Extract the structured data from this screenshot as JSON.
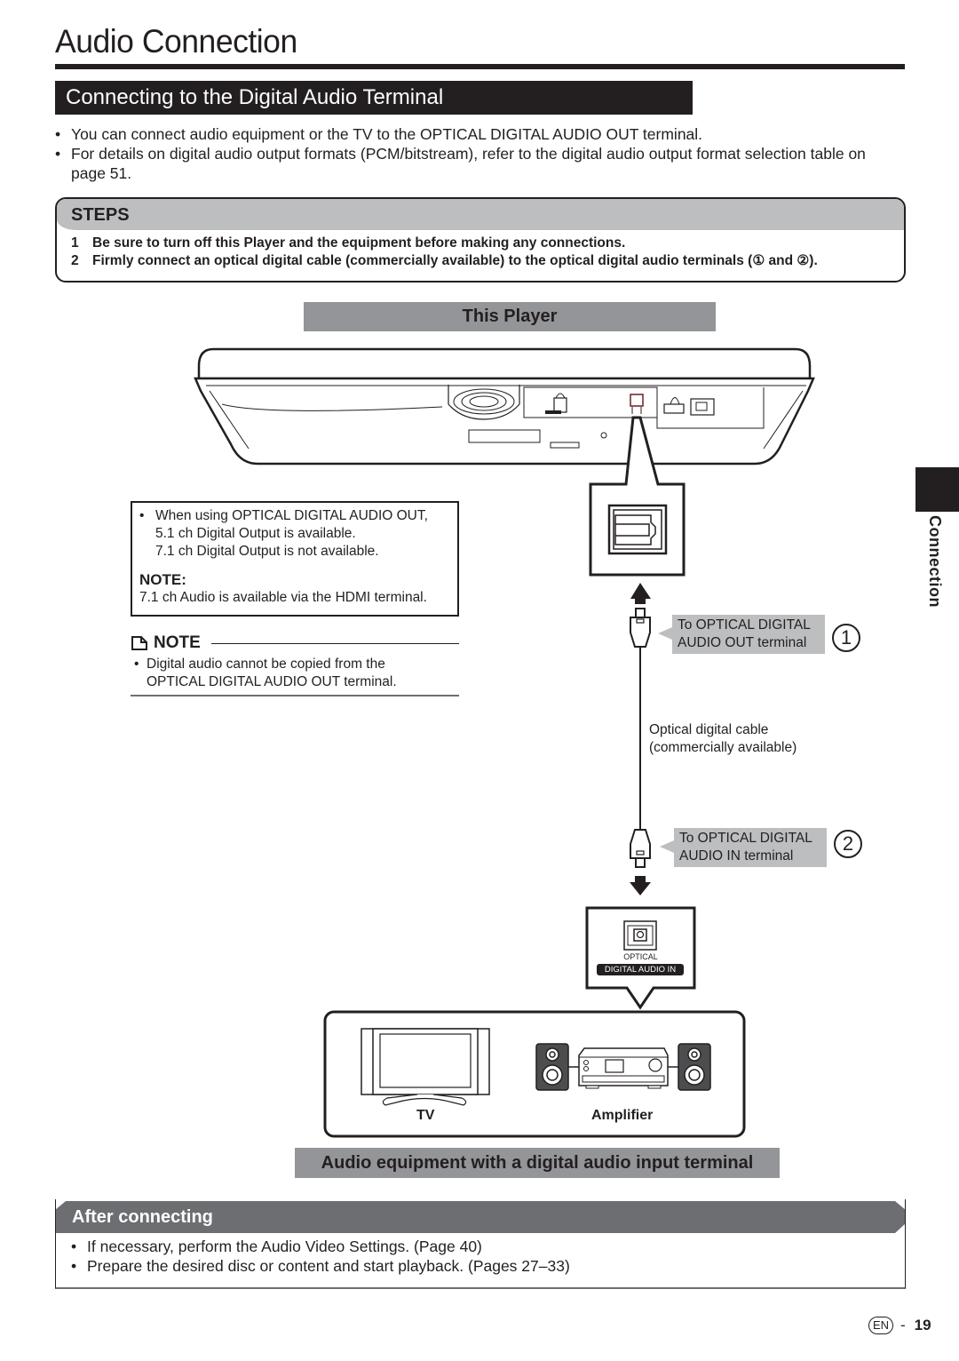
{
  "page": {
    "title": "Audio Connection",
    "section_title": "Connecting to the Digital Audio Terminal",
    "intro_bullets": [
      "You can connect audio equipment or the TV to the OPTICAL DIGITAL AUDIO OUT terminal.",
      "For details on digital audio output formats (PCM/bitstream), refer to the digital audio output format selection table on page 51."
    ],
    "bullet_char": "•"
  },
  "steps": {
    "heading": "STEPS",
    "items": [
      {
        "num": "1",
        "text": "Be sure to turn off this Player and the equipment before making any connections."
      },
      {
        "num": "2",
        "text": "Firmly connect an optical digital cable (commercially available) to the optical digital audio terminals (① and ②)."
      }
    ]
  },
  "diagram": {
    "player_label": "This Player",
    "note_box": {
      "bullet_line1": "When using OPTICAL DIGITAL AUDIO OUT,",
      "line2": "5.1 ch Digital Output is available.",
      "line3": "7.1 ch Digital Output is not available.",
      "note_heading": "NOTE:",
      "note_text": "7.1 ch Audio is available via the HDMI terminal."
    },
    "callout_out": {
      "line1": "To OPTICAL DIGITAL",
      "line2": "AUDIO OUT terminal",
      "marker": "1"
    },
    "cable_label": {
      "line1": "Optical digital cable",
      "line2": "(commercially available)"
    },
    "callout_in": {
      "line1": "To OPTICAL DIGITAL",
      "line2": "AUDIO IN terminal",
      "marker": "2"
    },
    "terminal_in": {
      "top": "OPTICAL",
      "bottom": "DIGITAL AUDIO IN"
    },
    "tv_label": "TV",
    "amp_label": "Amplifier",
    "equipment_label": "Audio equipment with a digital audio input terminal"
  },
  "note": {
    "heading": "NOTE",
    "bullet_line1": "Digital audio cannot be copied from the",
    "bullet_line2": "OPTICAL DIGITAL AUDIO OUT terminal."
  },
  "after_connecting": {
    "heading": "After connecting",
    "items": [
      "If necessary, perform the Audio Video Settings. (Page 40)",
      "Prepare the desired disc or content and start playback. (Pages 27–33)"
    ]
  },
  "side_tab": {
    "label": "Connection"
  },
  "footer": {
    "lang": "EN",
    "separator": "-",
    "page_number": "19"
  },
  "colors": {
    "ink": "#231f20",
    "light_gray": "#bcbec0",
    "mid_gray": "#939598",
    "dark_gray": "#6d6e71"
  }
}
